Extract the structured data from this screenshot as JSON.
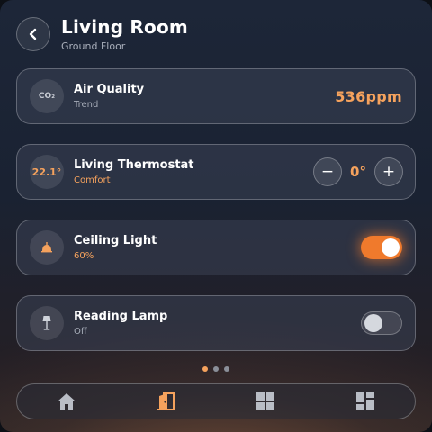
{
  "header": {
    "title": "Living Room",
    "subtitle": "Ground Floor",
    "back_icon": "chevron-left-icon"
  },
  "devices": {
    "air_quality": {
      "name": "Air Quality",
      "sub": "Trend",
      "icon_text": "CO₂",
      "value": "536ppm"
    },
    "thermostat": {
      "name": "Living Thermostat",
      "sub": "Comfort",
      "current_temp": "22.1°",
      "setpoint": "0°",
      "minus_label": "−",
      "plus_label": "+"
    },
    "ceiling_light": {
      "name": "Ceiling Light",
      "sub": "60%",
      "icon": "bell-lamp-icon",
      "on": true
    },
    "reading_lamp": {
      "name": "Reading Lamp",
      "sub": "Off",
      "icon": "floor-lamp-icon",
      "on": false
    }
  },
  "pager": {
    "pages": 3,
    "active": 1
  },
  "navbar": {
    "items": [
      "home-icon",
      "door-icon",
      "grid-icon",
      "dashboard-icon"
    ],
    "active": 1
  },
  "colors": {
    "accent": "#f5a25d",
    "toggle_on": "#f07a2c"
  }
}
